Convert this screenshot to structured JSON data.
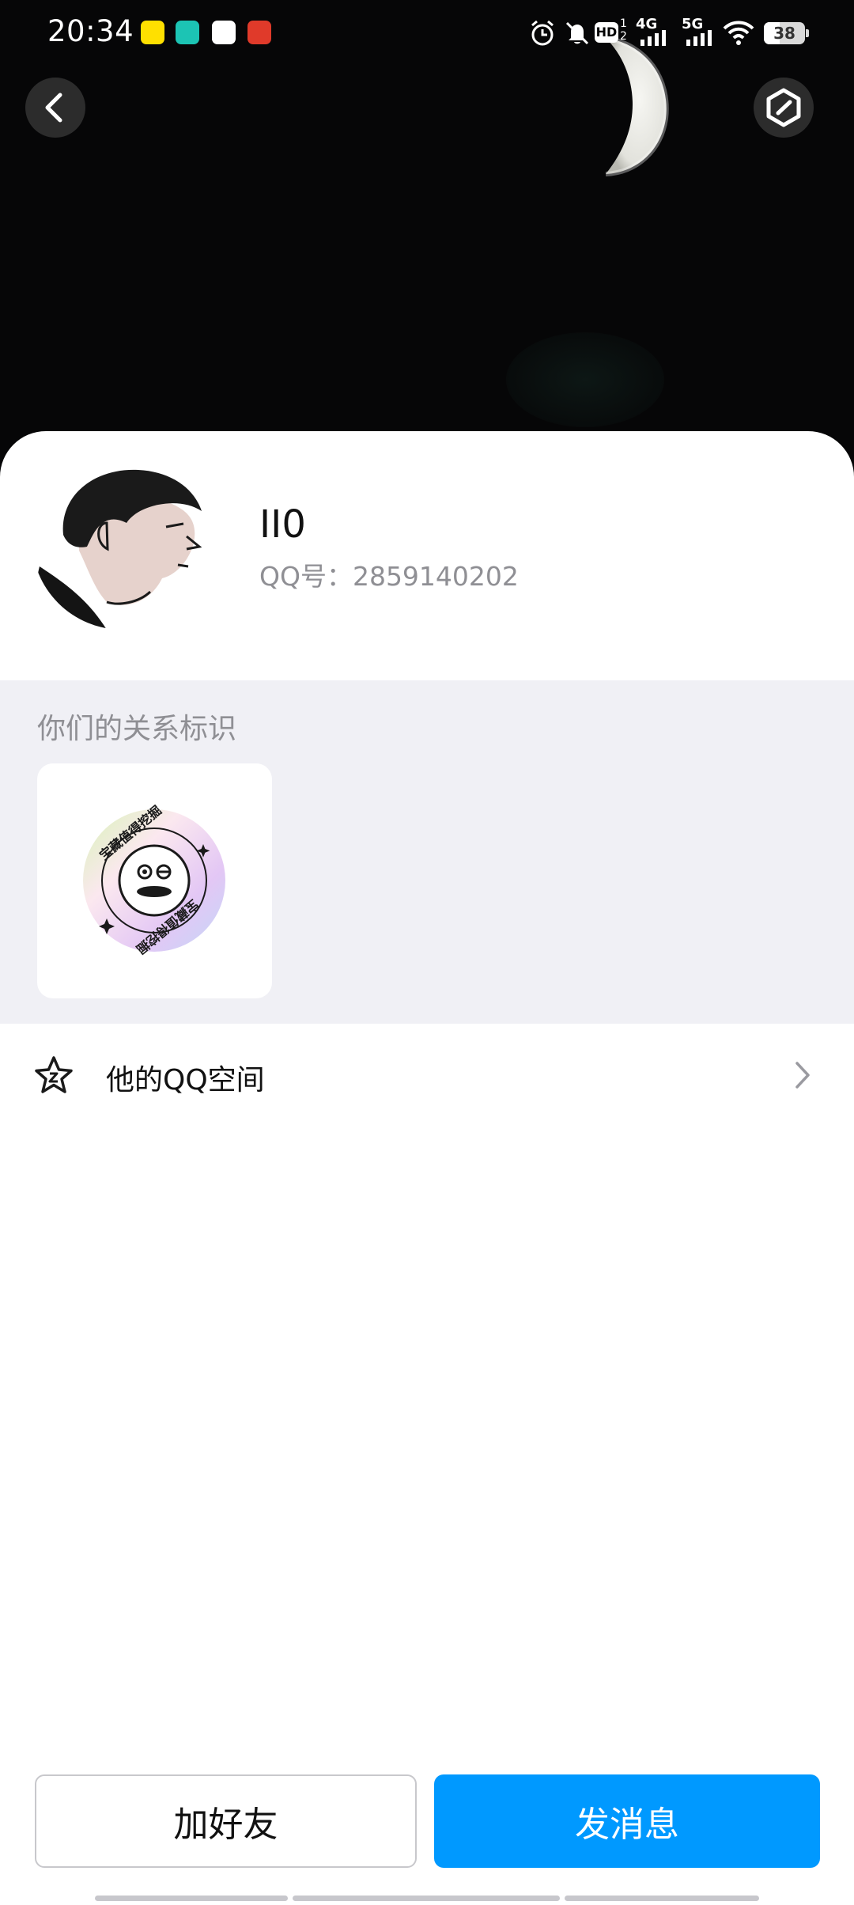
{
  "status_bar": {
    "time": "20:34",
    "app_icons": [
      "闲鱼",
      "BOSS直聘",
      "小红书",
      "外卖"
    ],
    "network_labels": [
      "HD",
      "4G",
      "5G"
    ],
    "battery": "38"
  },
  "header": {
    "back_icon": "chevron-left-icon",
    "settings_icon": "hexagon-icon"
  },
  "profile": {
    "name": "II0",
    "qq_label": "QQ号：2859140202"
  },
  "relation": {
    "title": "你们的关系标识",
    "badge_text": "宝藏值得挖掘"
  },
  "qzone": {
    "label": "他的QQ空间",
    "icon": "star-icon"
  },
  "actions": {
    "add_friend": "加好友",
    "send_message": "发消息"
  },
  "colors": {
    "accent": "#0099ff",
    "section_bg": "#f0f0f5",
    "muted_text": "#8f8f94"
  }
}
